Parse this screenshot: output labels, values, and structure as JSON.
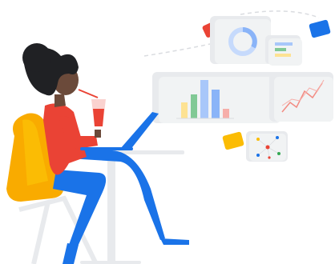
{
  "illustration": {
    "subject": "woman-at-laptop-with-floating-charts",
    "colors": {
      "blue": "#1a73e8",
      "red": "#ea4335",
      "yellow": "#fbbc04",
      "green": "#34a853",
      "skin": "#6b4a3a",
      "hair": "#202124",
      "card": "#f1f3f4",
      "card_shadow": "#e8eaed",
      "line": "#dadce0"
    },
    "floating_cards": [
      {
        "name": "donut-chart-card",
        "icon": "donut-chart"
      },
      {
        "name": "bar-legend-card",
        "icon": "bar-legend"
      },
      {
        "name": "bar-chart-card",
        "icon": "bar-chart"
      },
      {
        "name": "line-chart-card",
        "icon": "line-chart"
      },
      {
        "name": "network-card",
        "icon": "network-graph"
      }
    ]
  }
}
